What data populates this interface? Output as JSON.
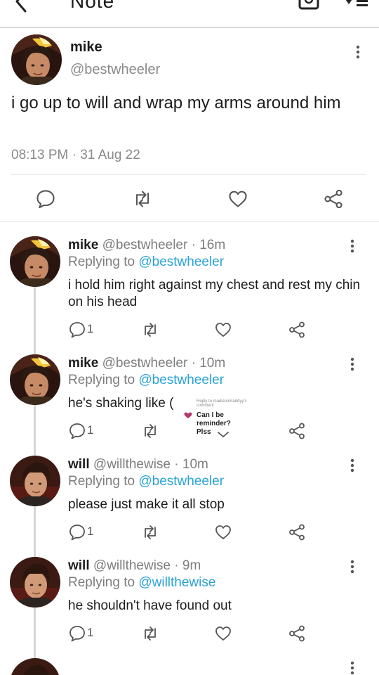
{
  "topbar": {
    "title": "Note"
  },
  "main_post": {
    "name": "mike",
    "handle": "@bestwheeler",
    "text": "i go up to will and wrap my arms around him",
    "timestamp": "08:13 PM · 31 Aug 22"
  },
  "replies": [
    {
      "name": "mike",
      "handle": "@bestwheeler",
      "time": "· 16m",
      "replying_prefix": "Replying to",
      "replying_to": "@bestwheeler",
      "text": "i hold him right against my chest and rest my chin on his head",
      "comment_count": "1"
    },
    {
      "name": "mike",
      "handle": "@bestwheeler",
      "time": "· 10m",
      "replying_prefix": "Replying to",
      "replying_to": "@bestwheeler",
      "text": "he's shaking like (",
      "comment_count": "1"
    },
    {
      "name": "will",
      "handle": "@willthewise",
      "time": "· 10m",
      "replying_prefix": "Replying to",
      "replying_to": "@bestwheeler",
      "text": "please just make it all stop",
      "comment_count": "1"
    },
    {
      "name": "will",
      "handle": "@willthewise",
      "time": "· 9m",
      "replying_prefix": "Replying to",
      "replying_to": "@willthewise",
      "text": "he shouldn't have found out",
      "comment_count": "1"
    }
  ],
  "overlay_comment": {
    "reply_to": "Reply to madisonmaddyy's comment",
    "question_line1": "Can I be reminder?",
    "question_line2": "Plss"
  },
  "icons": {
    "back": "back-arrow-icon",
    "camera": "camera-icon",
    "sort": "sort-icon",
    "comment": "comment-icon",
    "retweet": "retweet-icon",
    "like": "heart-icon",
    "share": "share-icon",
    "more": "more-vertical-icon"
  },
  "colors": {
    "link": "#2aa3d6",
    "muted": "#8a8a8a",
    "divider": "#e4e4e4"
  }
}
